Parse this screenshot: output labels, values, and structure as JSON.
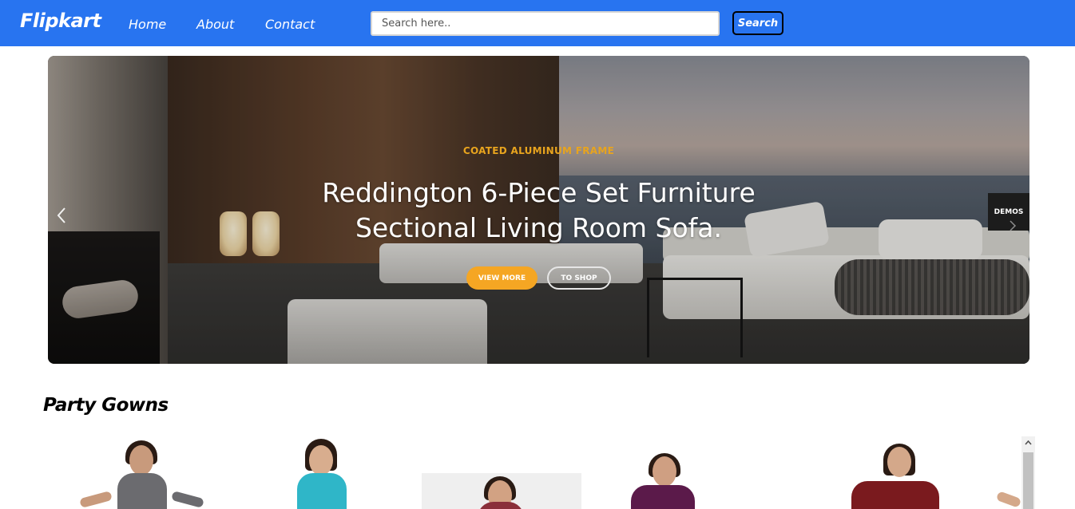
{
  "navbar": {
    "logo": "Flipkart",
    "links": [
      "Home",
      "About",
      "Contact"
    ],
    "search_placeholder": "Search here..",
    "search_button": "Search"
  },
  "carousel": {
    "kicker": "COATED ALUMINUM FRAME",
    "title_line1": "Reddington 6-Piece Set Furniture",
    "title_line2": "Sectional Living Room Sofa.",
    "primary_button": "VIEW MORE",
    "secondary_button": "TO SHOP",
    "side_tab": "DEMOS",
    "prev_icon": "chevron-left-icon",
    "next_icon": "chevron-right-icon"
  },
  "section": {
    "title": "Party Gowns",
    "products": [
      {
        "name": "gown-1",
        "color": "#6b6b6f"
      },
      {
        "name": "gown-2",
        "color": "#2fb6c8"
      },
      {
        "name": "gown-3",
        "color": "#8a2f3a"
      },
      {
        "name": "gown-4",
        "color": "#5b1a4a"
      },
      {
        "name": "gown-5",
        "color": "#7a1a1e"
      }
    ]
  },
  "colors": {
    "brand": "#2874f0",
    "accent": "#f5a623"
  }
}
